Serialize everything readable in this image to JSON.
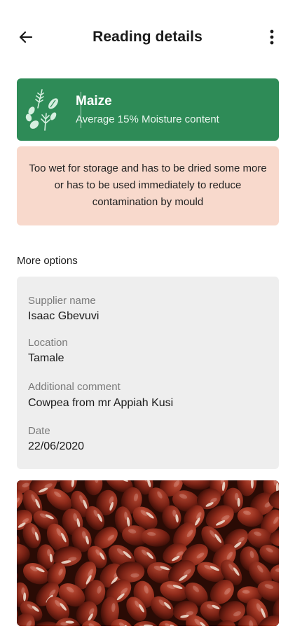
{
  "header": {
    "title": "Reading details",
    "back_icon": "arrow-left-icon",
    "menu_icon": "more-vertical-icon"
  },
  "crop": {
    "name": "Maize",
    "summary": "Average 15% Moisture content",
    "icon": "grains-icon",
    "color": "#2e8b57"
  },
  "warning": {
    "text": "Too wet for storage and has to be dried some more or has to be used immediately to reduce contamination by mould",
    "color": "#f8d9cc"
  },
  "more_options": {
    "label": "More options"
  },
  "details": {
    "supplier": {
      "label": "Supplier name",
      "value": "Isaac Gbevuvi"
    },
    "location": {
      "label": "Location",
      "value": "Tamale"
    },
    "comment": {
      "label": "Additional comment",
      "value": "Cowpea from mr Appiah Kusi"
    },
    "date": {
      "label": "Date",
      "value": "22/06/2020"
    }
  },
  "photo": {
    "subject": "red-beans-photo"
  }
}
